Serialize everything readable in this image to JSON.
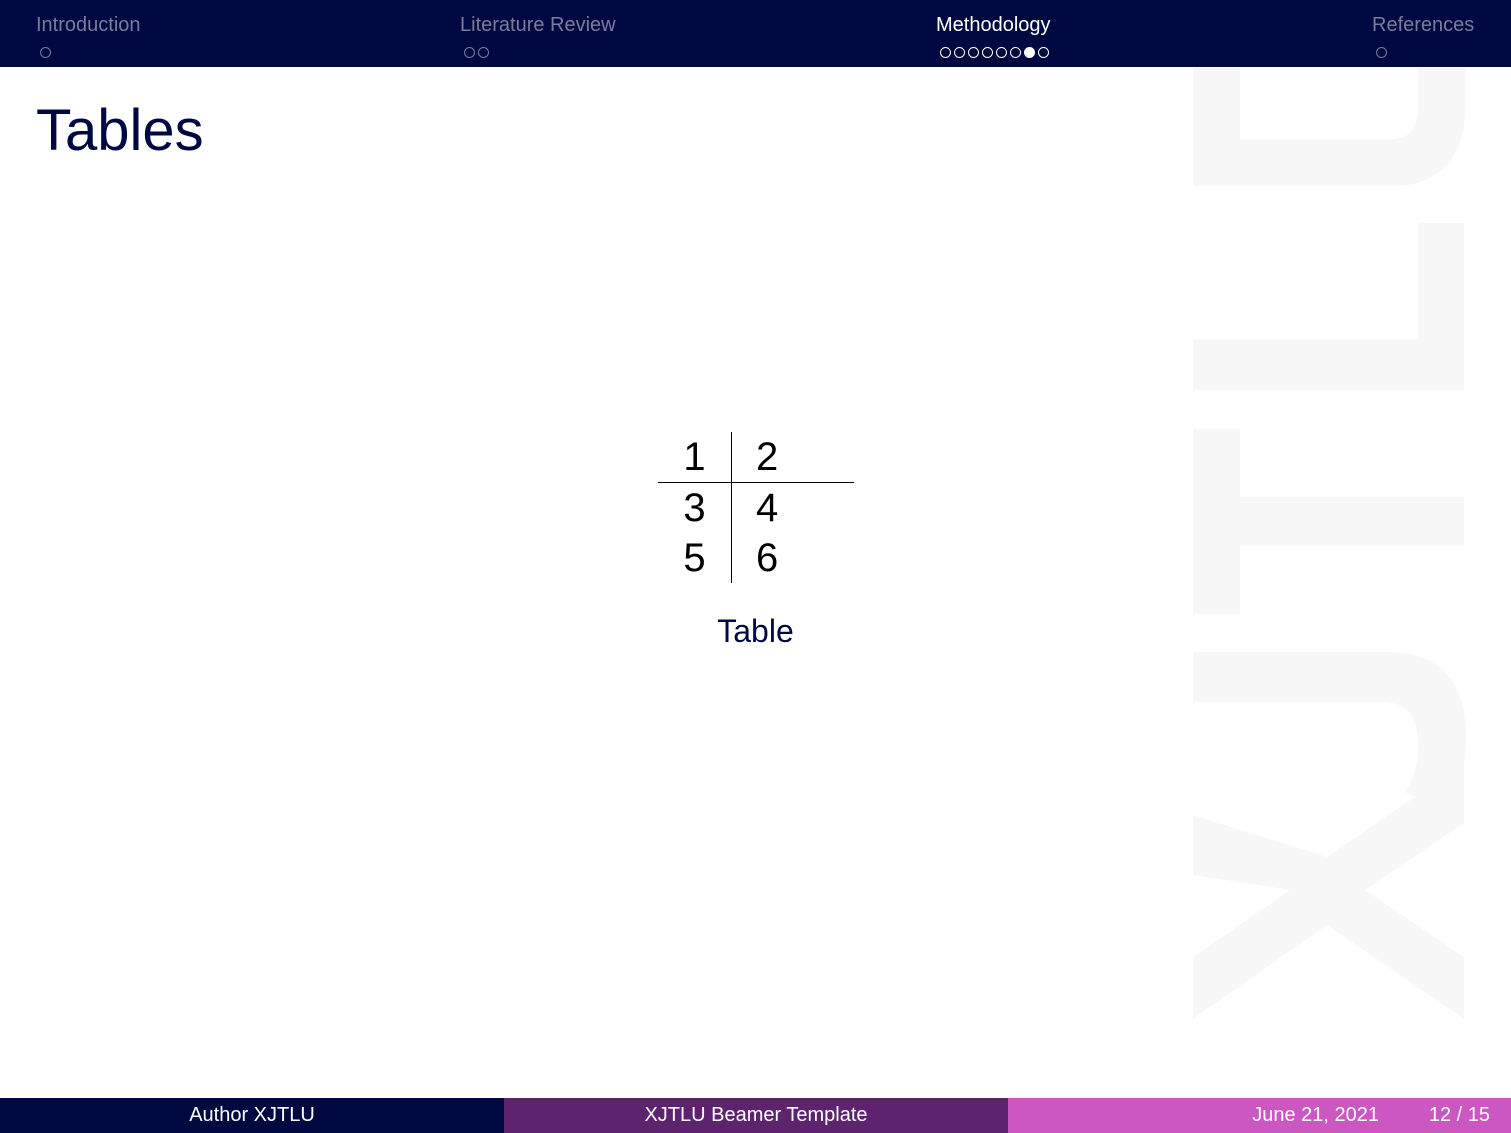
{
  "nav": {
    "sections": [
      {
        "label": "Introduction",
        "dots": 1,
        "current_dot": null,
        "active": false
      },
      {
        "label": "Literature Review",
        "dots": 2,
        "current_dot": null,
        "active": false
      },
      {
        "label": "Methodology",
        "dots": 8,
        "current_dot": 7,
        "active": true
      },
      {
        "label": "References",
        "dots": 1,
        "current_dot": null,
        "active": false
      }
    ]
  },
  "frame": {
    "title": "Tables"
  },
  "table": {
    "header": [
      "1",
      "2"
    ],
    "rows": [
      [
        "3",
        "4"
      ],
      [
        "5",
        "6"
      ]
    ],
    "caption": "Table"
  },
  "watermark": {
    "text": "XJTLU"
  },
  "footer": {
    "author": "Author XJTLU",
    "title": "XJTLU Beamer Template",
    "date": "June 21, 2021",
    "page": "12 / 15"
  },
  "colors": {
    "navy": "#000842",
    "purple": "#5e236f",
    "magenta": "#cc57c3",
    "nav_inactive": "#7a7c99",
    "watermark": "#f7f7f7"
  }
}
